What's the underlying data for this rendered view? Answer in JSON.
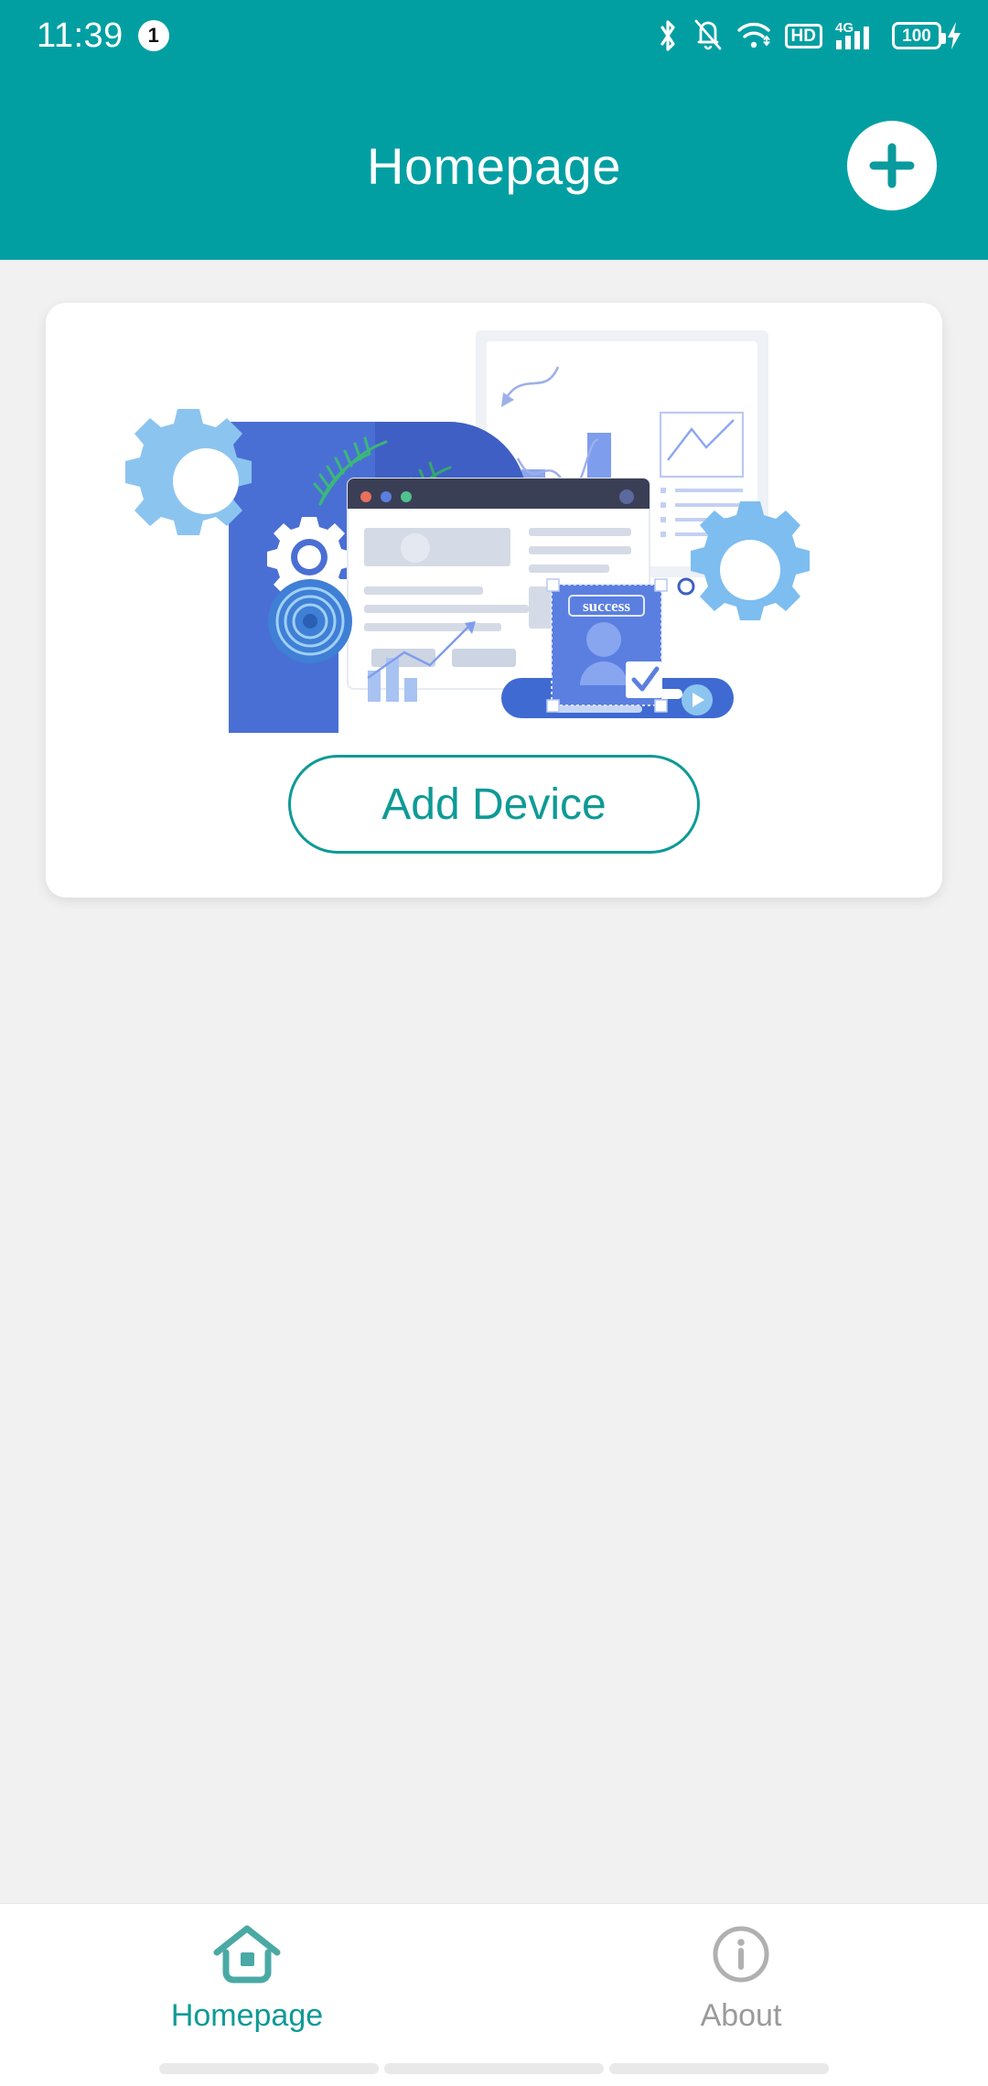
{
  "status_bar": {
    "time": "11:39",
    "notification_count": "1",
    "battery_level": "100",
    "hd_label": "HD",
    "network_label": "4G",
    "icons": [
      "bluetooth-icon",
      "bell-muted-icon",
      "wifi-icon",
      "hd-icon",
      "signal-4g-icon",
      "battery-icon",
      "charging-bolt-icon"
    ],
    "background_color": "#029fa2",
    "foreground_color": "#ffffff"
  },
  "app_bar": {
    "title": "Homepage",
    "add_button_icon": "plus-icon",
    "background_color": "#029fa2"
  },
  "card": {
    "illustration_name": "device-setup-illustration",
    "illustration_alt_text": "success",
    "add_device_label": "Add Device",
    "accent_color": "#0e9a96"
  },
  "bottom_nav": {
    "items": [
      {
        "label": "Homepage",
        "icon": "home-icon",
        "active": true,
        "color": "#0e9a96"
      },
      {
        "label": "About",
        "icon": "info-circle-icon",
        "active": false,
        "color": "#9a9a9a"
      }
    ]
  },
  "colors": {
    "page_background": "#f1f1f1",
    "card_background": "#ffffff",
    "teal": "#029fa2",
    "teal_dark": "#0e9a96"
  }
}
